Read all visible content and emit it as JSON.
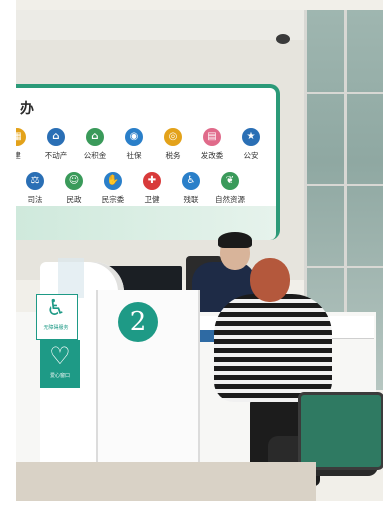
{
  "sign": {
    "title": "办",
    "services_row1": [
      {
        "label": "建",
        "icon": "building-icon",
        "color": "#e3a21a"
      },
      {
        "label": "不动产",
        "icon": "house-icon",
        "color": "#2a6fb5"
      },
      {
        "label": "公积金",
        "icon": "home-icon",
        "color": "#3a9a5a"
      },
      {
        "label": "社保",
        "icon": "shield-icon",
        "color": "#2a7fc9"
      },
      {
        "label": "税务",
        "icon": "eye-icon",
        "color": "#e3a21a"
      },
      {
        "label": "发改委",
        "icon": "doc-icon",
        "color": "#e06a8a"
      },
      {
        "label": "公安",
        "icon": "badge-icon",
        "color": "#2a6fb5"
      }
    ],
    "services_row2": [
      {
        "label": "司法",
        "icon": "scales-icon",
        "color": "#2a6fb5"
      },
      {
        "label": "民政",
        "icon": "people-icon",
        "color": "#3a9a5a"
      },
      {
        "label": "民宗委",
        "icon": "handshake-icon",
        "color": "#2a7fc9"
      },
      {
        "label": "卫健",
        "icon": "cross-icon",
        "color": "#d83a3a"
      },
      {
        "label": "残联",
        "icon": "wheelchair-icon",
        "color": "#2a7fc9"
      },
      {
        "label": "自然资源",
        "icon": "leaf-icon",
        "color": "#3a9a5a"
      }
    ]
  },
  "counter": {
    "number": "2",
    "accessible_label": "无障碍服务",
    "accessible_icon": "wheelchair-icon",
    "heart_label": "爱心窗口",
    "heart_icon": "heart-icon"
  },
  "colors": {
    "accent": "#1e9a86",
    "sign_border": "#2b9a78"
  }
}
